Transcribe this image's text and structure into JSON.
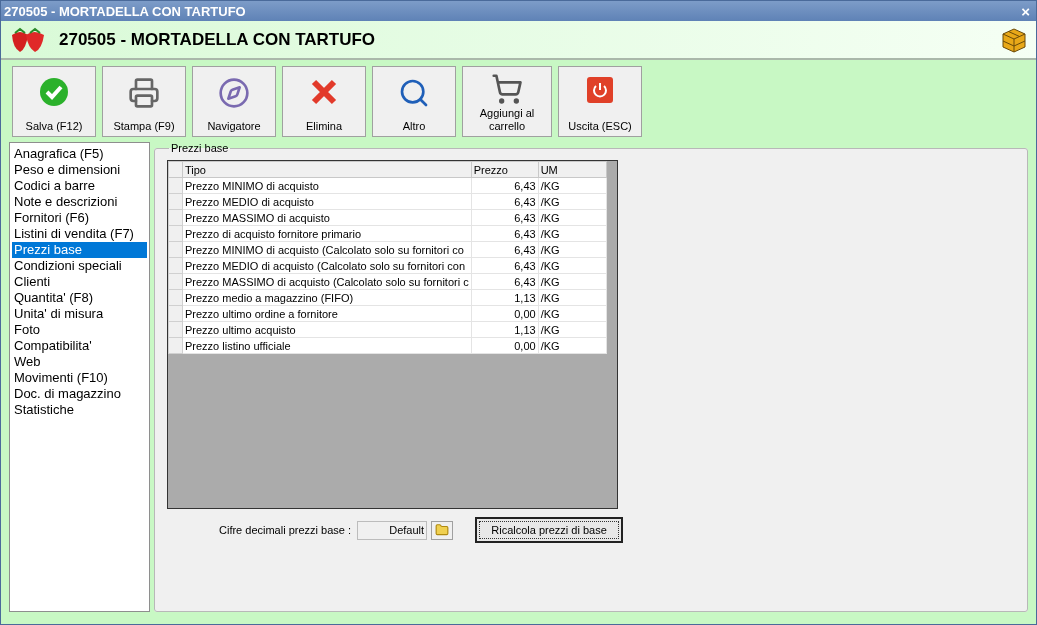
{
  "window": {
    "title": "270505 - MORTADELLA CON TARTUFO",
    "close": "×"
  },
  "header": {
    "title": "270505 - MORTADELLA CON TARTUFO"
  },
  "toolbar": [
    {
      "label": "Salva (F12)"
    },
    {
      "label": "Stampa (F9)"
    },
    {
      "label": "Navigatore"
    },
    {
      "label": "Elimina"
    },
    {
      "label": "Altro"
    },
    {
      "label": "Aggiungi al\ncarrello"
    },
    {
      "label": "Uscita (ESC)"
    }
  ],
  "sidebar": {
    "items": [
      {
        "label": "Anagrafica (F5)",
        "selected": false
      },
      {
        "label": "Peso e dimensioni",
        "selected": false
      },
      {
        "label": "Codici a barre",
        "selected": false
      },
      {
        "label": "Note e descrizioni",
        "selected": false
      },
      {
        "label": "Fornitori (F6)",
        "selected": false
      },
      {
        "label": "Listini di vendita (F7)",
        "selected": false
      },
      {
        "label": "Prezzi base",
        "selected": true
      },
      {
        "label": "Condizioni speciali",
        "selected": false
      },
      {
        "label": "Clienti",
        "selected": false
      },
      {
        "label": "Quantita' (F8)",
        "selected": false
      },
      {
        "label": "Unita' di misura",
        "selected": false
      },
      {
        "label": "Foto",
        "selected": false
      },
      {
        "label": "Compatibilita'",
        "selected": false
      },
      {
        "label": "Web",
        "selected": false
      },
      {
        "label": "Movimenti (F10)",
        "selected": false
      },
      {
        "label": "Doc. di magazzino",
        "selected": false
      },
      {
        "label": "Statistiche",
        "selected": false
      }
    ]
  },
  "panel": {
    "title": "Prezzi base",
    "table": {
      "columns": [
        "Tipo",
        "Prezzo",
        "UM"
      ],
      "rows": [
        {
          "tipo": "Prezzo MINIMO di acquisto",
          "prezzo": "6,43",
          "um": "/KG"
        },
        {
          "tipo": "Prezzo MEDIO di acquisto",
          "prezzo": "6,43",
          "um": "/KG"
        },
        {
          "tipo": "Prezzo MASSIMO di acquisto",
          "prezzo": "6,43",
          "um": "/KG"
        },
        {
          "tipo": "Prezzo di acquisto fornitore primario",
          "prezzo": "6,43",
          "um": "/KG"
        },
        {
          "tipo": "Prezzo MINIMO di acquisto (Calcolato solo su fornitori co",
          "prezzo": "6,43",
          "um": "/KG"
        },
        {
          "tipo": "Prezzo MEDIO di acquisto (Calcolato solo su fornitori con",
          "prezzo": "6,43",
          "um": "/KG"
        },
        {
          "tipo": "Prezzo MASSIMO di acquisto (Calcolato solo su fornitori c",
          "prezzo": "6,43",
          "um": "/KG"
        },
        {
          "tipo": "Prezzo medio a magazzino (FIFO)",
          "prezzo": "1,13",
          "um": "/KG"
        },
        {
          "tipo": "Prezzo ultimo ordine a fornitore",
          "prezzo": "0,00",
          "um": "/KG"
        },
        {
          "tipo": "Prezzo ultimo acquisto",
          "prezzo": "1,13",
          "um": "/KG"
        },
        {
          "tipo": "Prezzo listino ufficiale",
          "prezzo": "0,00",
          "um": "/KG"
        }
      ]
    },
    "decimals": {
      "label": "Cifre decimali prezzi base :",
      "value": "Default"
    },
    "recalc_button": "Ricalcola prezzi di base"
  }
}
